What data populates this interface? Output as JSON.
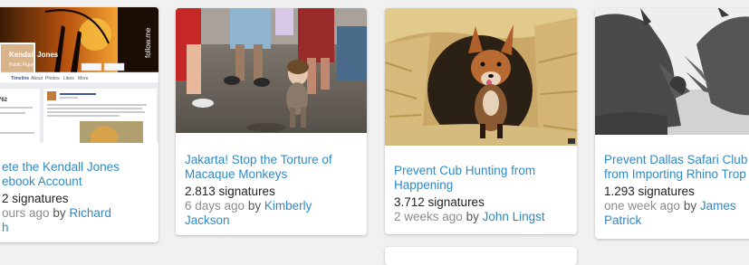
{
  "cards": [
    {
      "title": "ete the Kendall Jones\nebook Account",
      "signatures": "2 signatures",
      "time": "ours ago",
      "by": "by",
      "author": "Richard\nh",
      "thumb": {
        "profile_name": "Kendall Jones",
        "profile_type": "Public Figure",
        "side_text": "follow.me",
        "tabs": [
          "Timeline",
          "About",
          "Photos",
          "Likes",
          "More"
        ],
        "count": "762"
      }
    },
    {
      "title": "Jakarta! Stop the Torture of\nMacaque Monkeys",
      "signatures": "2.813 signatures",
      "time": "6 days ago",
      "by": "by",
      "author": "Kimberly\nJackson"
    },
    {
      "title": "Prevent Cub Hunting from\nHappening",
      "signatures": "3.712 signatures",
      "time": "2 weeks ago",
      "by": "by",
      "author": "John Lingst"
    },
    {
      "title": "Prevent Dallas Safari Club\nfrom Importing Rhino Trop",
      "signatures": "1.293 signatures",
      "time": "one week ago",
      "by": "by",
      "author": "James\nPatrick"
    }
  ]
}
